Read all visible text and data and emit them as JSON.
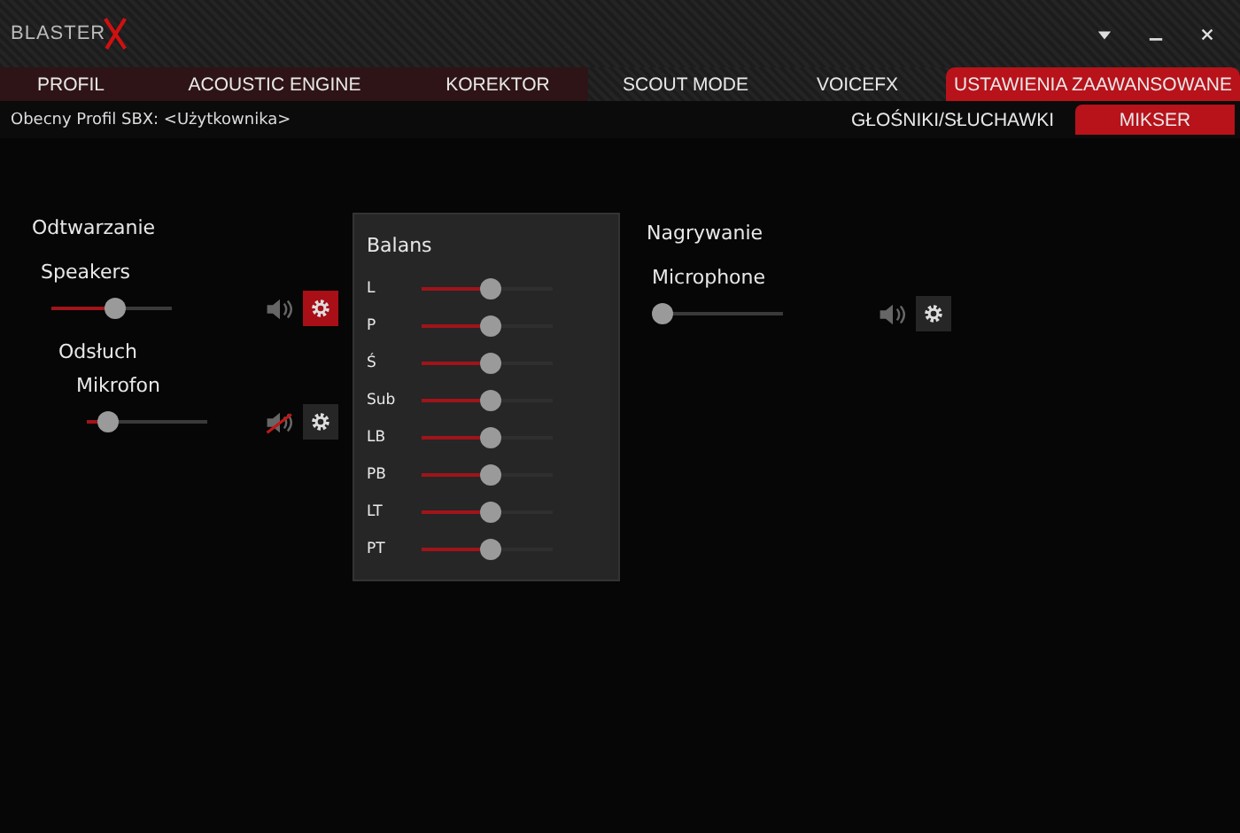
{
  "logo": {
    "text": "BLASTER"
  },
  "tabs": [
    {
      "label": "PROFIL",
      "selected": false
    },
    {
      "label": "ACOUSTIC ENGINE",
      "selected": false
    },
    {
      "label": "KOREKTOR",
      "selected": false
    },
    {
      "label": "SCOUT MODE",
      "selected": false
    },
    {
      "label": "VOICEFX",
      "selected": false
    },
    {
      "label": "USTAWIENIA ZAAWANSOWANE",
      "selected": true
    }
  ],
  "profile_label": "Obecny Profil SBX: <Użytkownika>",
  "subtabs": [
    {
      "label": "GŁOŚNIKI/SŁUCHAWKI",
      "selected": false
    },
    {
      "label": "MIKSER",
      "selected": true
    }
  ],
  "playback": {
    "title": "Odtwarzanie",
    "device": {
      "name": "Speakers",
      "level": 0.45,
      "muted": false,
      "settings_open": true
    }
  },
  "monitoring": {
    "title": "Odsłuch",
    "device": {
      "name": "Mikrofon",
      "level": 0.15,
      "muted": true,
      "settings_open": false
    }
  },
  "balance": {
    "title": "Balans",
    "channels": [
      {
        "label": "L",
        "level": 0.45
      },
      {
        "label": "P",
        "level": 0.45
      },
      {
        "label": "Ś",
        "level": 0.45
      },
      {
        "label": "Sub",
        "level": 0.45
      },
      {
        "label": "LB",
        "level": 0.45
      },
      {
        "label": "PB",
        "level": 0.45
      },
      {
        "label": "LT",
        "level": 0.45
      },
      {
        "label": "PT",
        "level": 0.45
      }
    ]
  },
  "recording": {
    "title": "Nagrywanie",
    "device": {
      "name": "Microphone",
      "level": 0.0,
      "muted": false,
      "settings_open": false
    }
  }
}
